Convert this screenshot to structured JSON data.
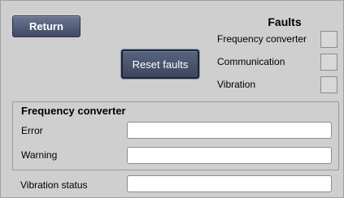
{
  "buttons": {
    "return_label": "Return",
    "reset_faults_label": "Reset faults"
  },
  "faults": {
    "title": "Faults",
    "items": [
      {
        "label": "Frequency converter",
        "active": false
      },
      {
        "label": "Communication",
        "active": false
      },
      {
        "label": "Vibration",
        "active": false
      }
    ]
  },
  "frequency_converter": {
    "title": "Frequency converter",
    "error_label": "Error",
    "error_value": "",
    "warning_label": "Warning",
    "warning_value": ""
  },
  "vibration": {
    "status_label": "Vibration status",
    "status_value": ""
  },
  "colors": {
    "background": "#cfcfcf",
    "button": "#4a5570",
    "indicator": "#d8d8d8",
    "field": "#ffffff"
  }
}
